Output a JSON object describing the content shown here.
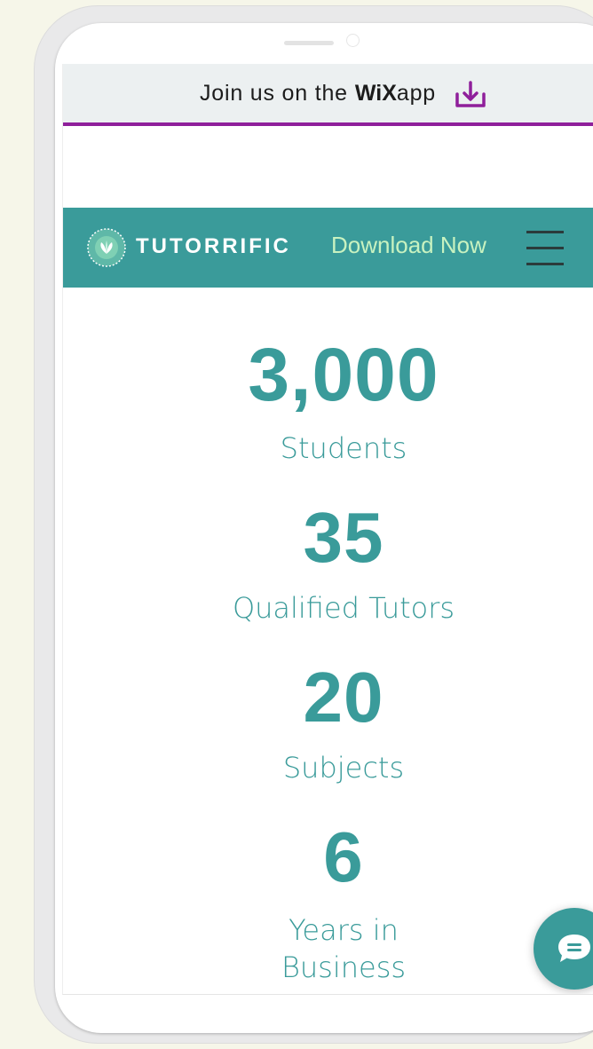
{
  "wix_banner": {
    "text": "Join us on the",
    "brand": "WiX",
    "suffix": "app",
    "accent_color": "#8f1f9b"
  },
  "header": {
    "brand_name": "TUTORRIFIC",
    "download_label": "Download Now",
    "background_color": "#3a9b9a",
    "link_color": "#c8f2c0",
    "menu_icon": "hamburger-menu-icon",
    "logo_icon": "tutorrific-logo"
  },
  "stats": [
    {
      "value": "3,000",
      "label": "Students"
    },
    {
      "value": "35",
      "label": "Qualified Tutors"
    },
    {
      "value": "20",
      "label": "Subjects"
    },
    {
      "value": "6",
      "label": "Years in Business"
    }
  ],
  "chat": {
    "icon": "chat-bubble-icon"
  }
}
